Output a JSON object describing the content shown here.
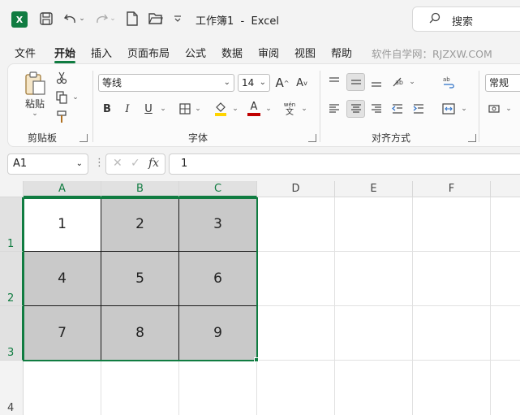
{
  "app": {
    "logo": "X",
    "title": "工作簿1",
    "title_sep": "-",
    "app_name": "Excel",
    "search_placeholder": "搜索"
  },
  "tabs": [
    "文件",
    "开始",
    "插入",
    "页面布局",
    "公式",
    "数据",
    "审阅",
    "视图",
    "帮助"
  ],
  "active_tab": "开始",
  "watermark": "软件自学网：RJZXW.COM",
  "ribbon": {
    "clipboard": {
      "label": "剪贴板",
      "paste": "粘贴"
    },
    "font": {
      "label": "字体",
      "font_name": "等线",
      "font_size": "14",
      "grow": "A",
      "shrink": "A",
      "bold": "B",
      "italic": "I",
      "underline": "U",
      "font_color_letter": "A",
      "phonetic_top": "wén",
      "phonetic_bottom": "文",
      "highlight_color": "#ffd400",
      "font_color": "#c00000"
    },
    "alignment": {
      "label": "对齐方式"
    },
    "number": {
      "format": "常规"
    }
  },
  "formula_bar": {
    "name_box": "A1",
    "fx": "fx",
    "value": "1"
  },
  "grid": {
    "columns": [
      "A",
      "B",
      "C",
      "D",
      "E",
      "F"
    ],
    "rows": [
      "1",
      "2",
      "3",
      "4"
    ],
    "cells": [
      [
        "1",
        "2",
        "3"
      ],
      [
        "4",
        "5",
        "6"
      ],
      [
        "7",
        "8",
        "9"
      ]
    ],
    "fill_color": "#c9c9c9",
    "accent": "#107c41"
  }
}
